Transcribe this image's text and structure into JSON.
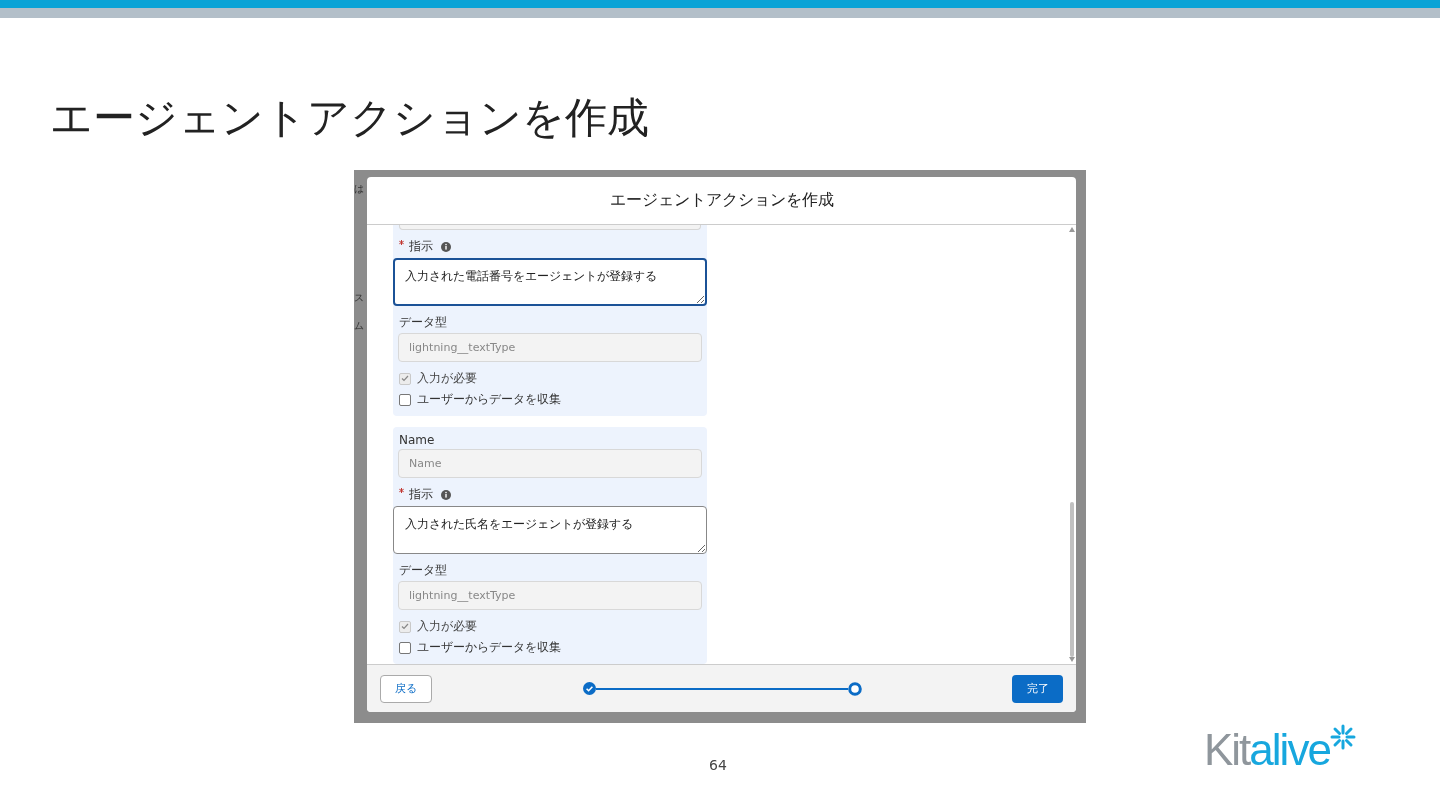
{
  "slide": {
    "title": "エージェントアクションを作成",
    "page_number": "64",
    "logo": {
      "first_part": "Kit",
      "second_part": "alive"
    }
  },
  "background_fragments": [
    "は",
    "ス",
    "ム"
  ],
  "dialog": {
    "title": "エージェントアクションを作成",
    "groups": [
      {
        "instruction": {
          "label": "指示",
          "required": true,
          "value": "入力された電話番号をエージェントが登録する",
          "focused": true
        },
        "data_type": {
          "label": "データ型",
          "value": "lightning__textType"
        },
        "checkboxes": [
          {
            "label": "入力が必要",
            "checked": true,
            "disabled": true
          },
          {
            "label": "ユーザーからデータを収集",
            "checked": false,
            "disabled": false
          }
        ]
      },
      {
        "name": {
          "label": "Name",
          "placeholder": "Name"
        },
        "instruction": {
          "label": "指示",
          "required": true,
          "value": "入力された氏名をエージェントが登録する",
          "focused": false
        },
        "data_type": {
          "label": "データ型",
          "value": "lightning__textType"
        },
        "checkboxes": [
          {
            "label": "入力が必要",
            "checked": true,
            "disabled": true
          },
          {
            "label": "ユーザーからデータを収集",
            "checked": false,
            "disabled": false
          }
        ]
      }
    ],
    "footer": {
      "back_button": "戻る",
      "finish_button": "完了",
      "steps": [
        {
          "kind": "complete"
        },
        {
          "kind": "current"
        }
      ]
    }
  }
}
